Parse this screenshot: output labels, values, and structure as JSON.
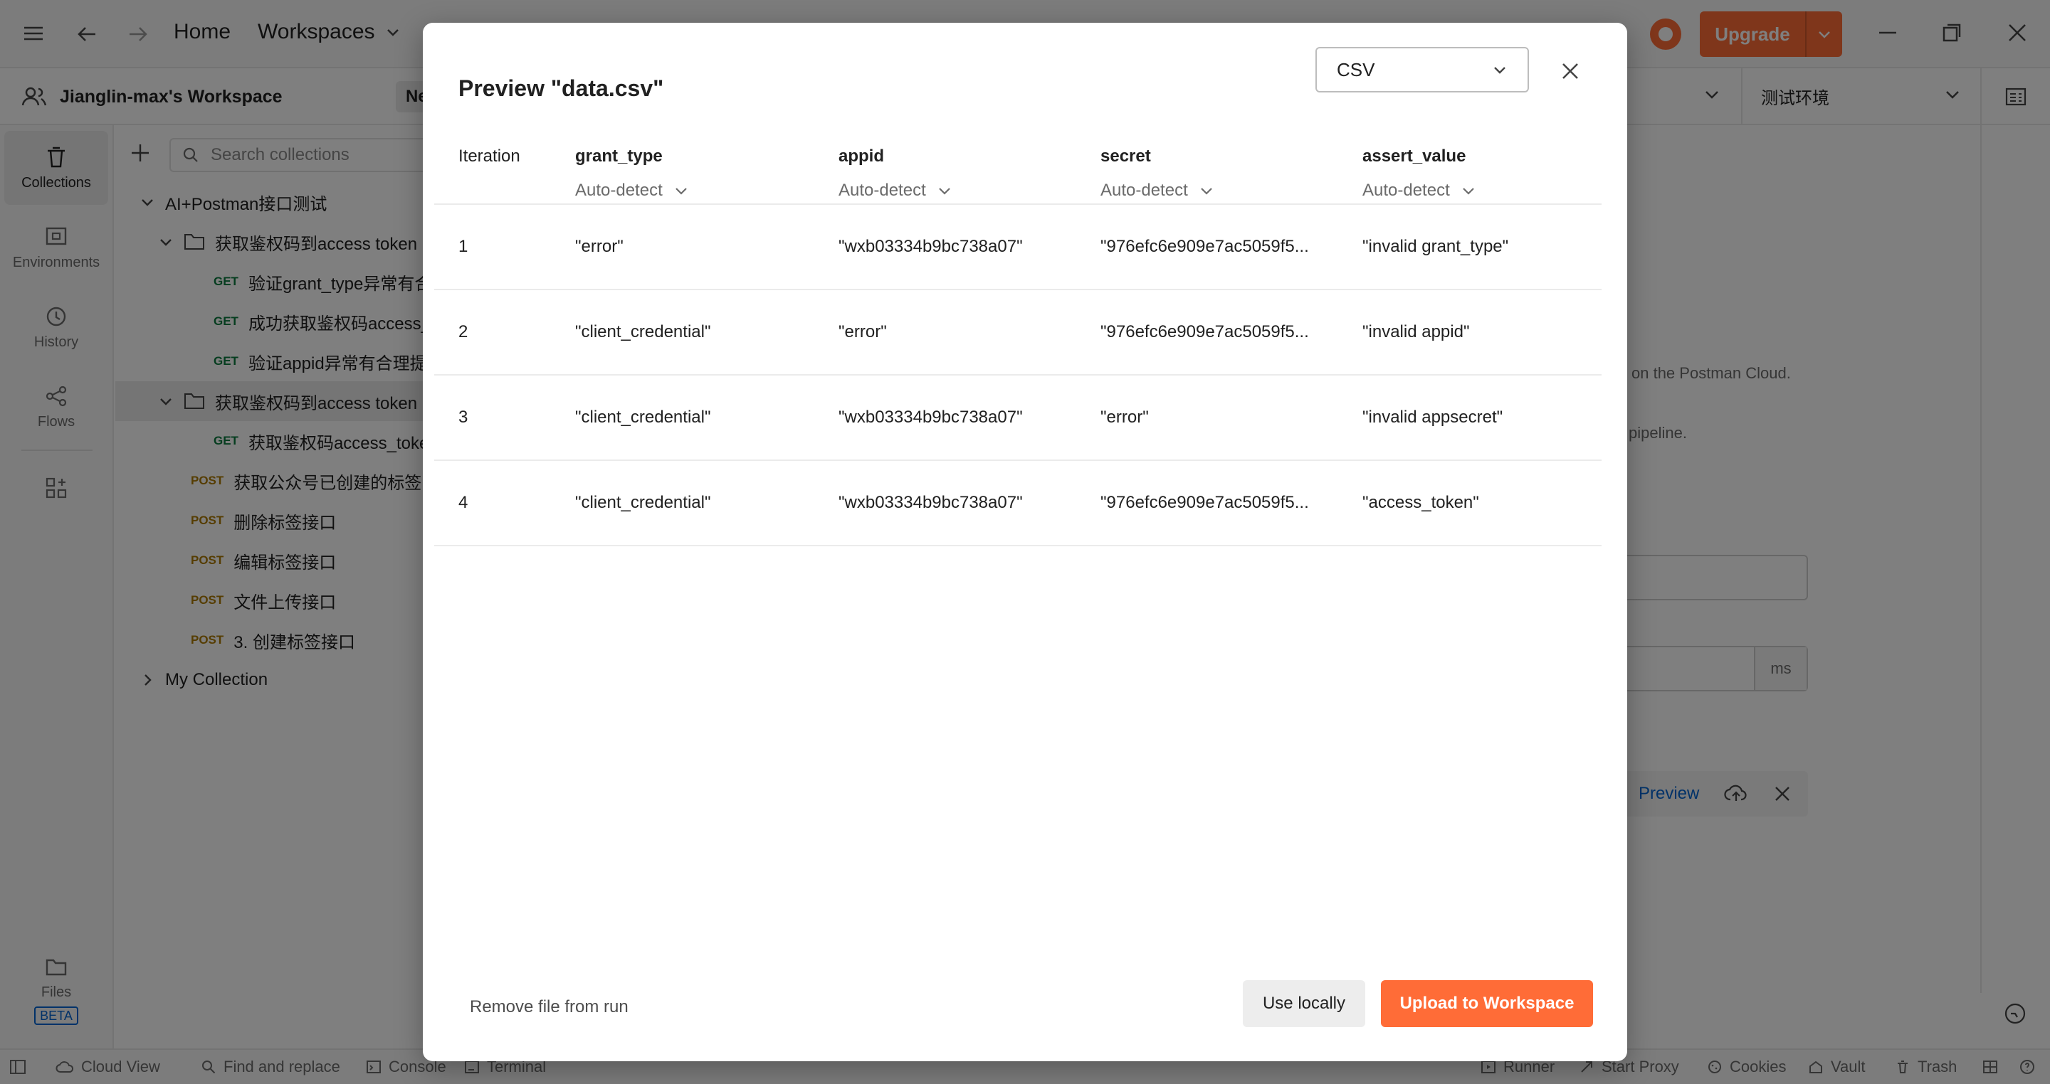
{
  "topbar": {
    "home": "Home",
    "workspaces": "Workspaces",
    "upgrade": "Upgrade"
  },
  "workspace": {
    "name": "Jianglin-max's Workspace",
    "new_label": "Ne",
    "environment": "测试环境"
  },
  "sidebar": {
    "items": [
      {
        "label": "Collections"
      },
      {
        "label": "Environments"
      },
      {
        "label": "History"
      },
      {
        "label": "Flows"
      }
    ],
    "files_label": "Files",
    "beta": "BETA"
  },
  "collections": {
    "search_placeholder": "Search collections",
    "rows": [
      {
        "method": "",
        "label": "AI+Postman接口测试",
        "indent": 0,
        "chevron": "down"
      },
      {
        "method": "",
        "label": "获取鉴权码到access token",
        "indent": 1,
        "chevron": "down",
        "folder": true
      },
      {
        "method": "GET",
        "label": "验证grant_type异常有合理提示",
        "indent": 2
      },
      {
        "method": "GET",
        "label": "成功获取鉴权码access_token",
        "indent": 2
      },
      {
        "method": "GET",
        "label": "验证appid异常有合理提示",
        "indent": 2
      },
      {
        "method": "",
        "label": "获取鉴权码到access token",
        "indent": 1,
        "chevron": "down",
        "folder": true,
        "selected": true
      },
      {
        "method": "GET",
        "label": "获取鉴权码access_token",
        "indent": 2
      },
      {
        "method": "POST",
        "label": "获取公众号已创建的标签",
        "indent": 1
      },
      {
        "method": "POST",
        "label": "删除标签接口",
        "indent": 1
      },
      {
        "method": "POST",
        "label": "编辑标签接口",
        "indent": 1
      },
      {
        "method": "POST",
        "label": "文件上传接口",
        "indent": 1
      },
      {
        "method": "POST",
        "label": "3. 创建标签接口",
        "indent": 1
      },
      {
        "method": "",
        "label": "My Collection",
        "indent": 0,
        "chevron": "right"
      }
    ]
  },
  "background": {
    "cloud_text": "on the Postman Cloud.",
    "pipeline_text": "pipeline.",
    "ms_unit": "ms",
    "preview_link": "Preview"
  },
  "statusbar": {
    "cloud_view": "Cloud View",
    "find_replace": "Find and replace",
    "console": "Console",
    "terminal": "Terminal",
    "runner": "Runner",
    "start_proxy": "Start Proxy",
    "cookies": "Cookies",
    "vault": "Vault",
    "trash": "Trash"
  },
  "modal": {
    "title": "Preview \"data.csv\"",
    "format": "CSV",
    "columns": [
      {
        "name": "Iteration",
        "type": ""
      },
      {
        "name": "grant_type",
        "type": "Auto-detect"
      },
      {
        "name": "appid",
        "type": "Auto-detect"
      },
      {
        "name": "secret",
        "type": "Auto-detect"
      },
      {
        "name": "assert_value",
        "type": "Auto-detect"
      }
    ],
    "rows": [
      [
        "1",
        "\"error\"",
        "\"wxb03334b9bc738a07\"",
        "\"976efc6e909e7ac5059f5...",
        "\"invalid grant_type\""
      ],
      [
        "2",
        "\"client_credential\"",
        "\"error\"",
        "\"976efc6e909e7ac5059f5...",
        "\"invalid appid\""
      ],
      [
        "3",
        "\"client_credential\"",
        "\"wxb03334b9bc738a07\"",
        "\"error\"",
        "\"invalid appsecret\""
      ],
      [
        "4",
        "\"client_credential\"",
        "\"wxb03334b9bc738a07\"",
        "\"976efc6e909e7ac5059f5...",
        "\"access_token\""
      ]
    ],
    "remove_label": "Remove file from run",
    "use_locally": "Use locally",
    "upload": "Upload to Workspace"
  },
  "colors": {
    "accent": "#ff6c37",
    "get": "#0b7b3e",
    "post": "#ad7a03"
  }
}
